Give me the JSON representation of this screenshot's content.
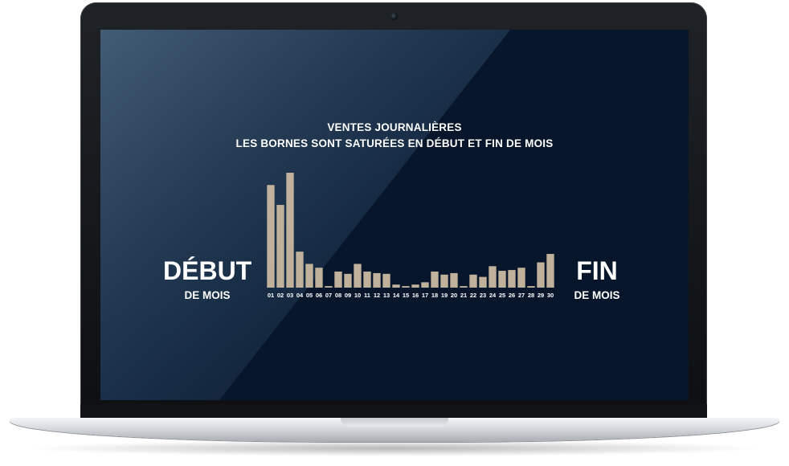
{
  "screen": {
    "title_line1": "VENTES JOURNALIÈRES",
    "title_line2": "LES BORNES SONT SATURÉES EN DÉBUT ET FIN DE MOIS",
    "left_big": "DÉBUT",
    "left_small": "DE MOIS",
    "right_big": "FIN",
    "right_small": "DE MOIS"
  },
  "colors": {
    "bar": "#bfb19b",
    "text": "#ffffff",
    "background": "#07162a"
  },
  "chart_data": {
    "type": "bar",
    "title": "",
    "xlabel": "",
    "ylabel": "",
    "categories": [
      "01",
      "02",
      "03",
      "04",
      "05",
      "06",
      "07",
      "08",
      "09",
      "10",
      "11",
      "12",
      "13",
      "14",
      "15",
      "16",
      "17",
      "18",
      "19",
      "20",
      "21",
      "22",
      "23",
      "24",
      "25",
      "26",
      "27",
      "28",
      "29",
      "30"
    ],
    "values": [
      134,
      108,
      150,
      47,
      31,
      26,
      2,
      21,
      18,
      31,
      21,
      19,
      18,
      4,
      2,
      4,
      7,
      21,
      17,
      19,
      2,
      17,
      14,
      28,
      22,
      23,
      26,
      2,
      33,
      44
    ],
    "ylim": [
      0,
      150
    ],
    "grid": false,
    "legend": "none"
  }
}
